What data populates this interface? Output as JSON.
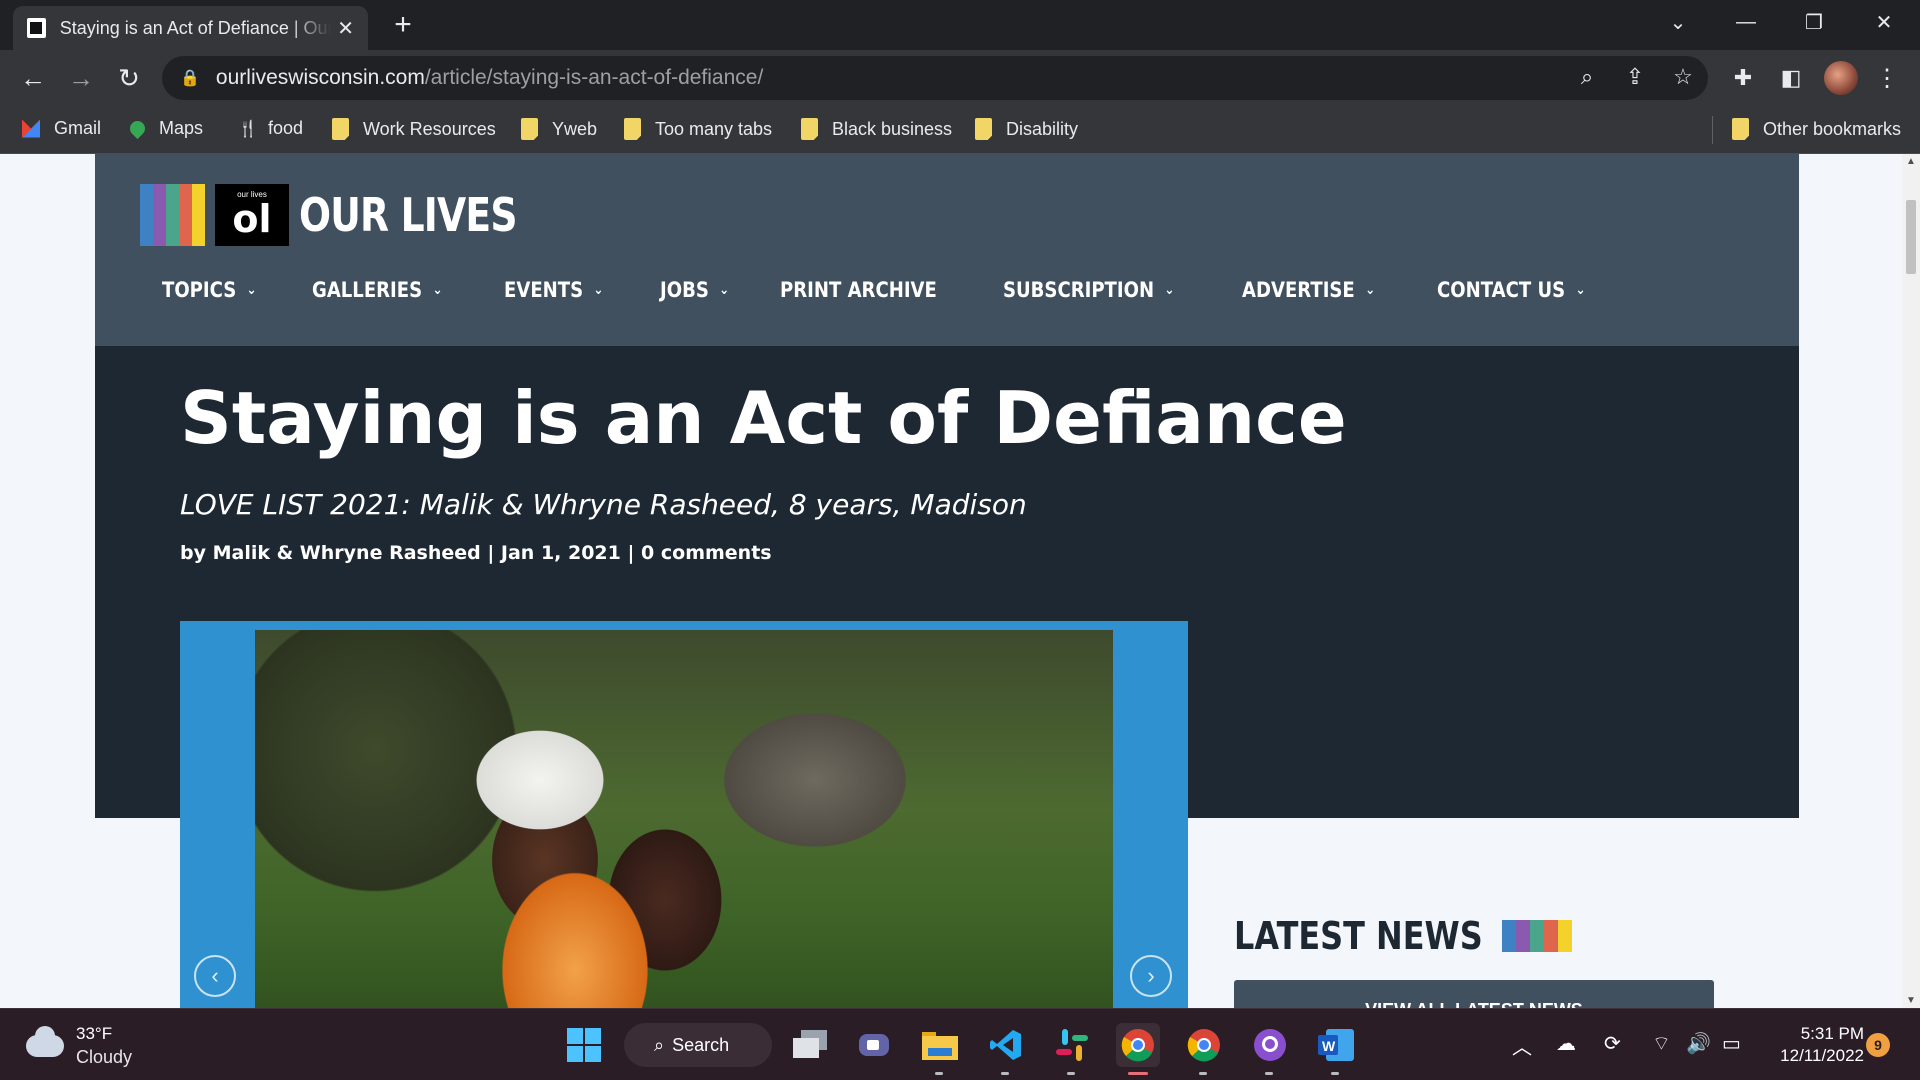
{
  "browser": {
    "tab_title": "Staying is an Act of Defiance | Our Lives",
    "url_host": "ourliveswisconsin.com",
    "url_path": "/article/staying-is-an-act-of-defiance/",
    "bookmarks": [
      {
        "label": "Gmail",
        "icon": "gmail-icon"
      },
      {
        "label": "Maps",
        "icon": "maps-icon"
      },
      {
        "label": "food",
        "icon": "food-icon"
      },
      {
        "label": "Work Resources",
        "icon": "folder-icon"
      },
      {
        "label": "Yweb",
        "icon": "folder-icon"
      },
      {
        "label": "Too many tabs",
        "icon": "folder-icon"
      },
      {
        "label": "Black business",
        "icon": "folder-icon"
      },
      {
        "label": "Disability",
        "icon": "folder-icon"
      }
    ],
    "other_bookmarks": "Other bookmarks"
  },
  "site": {
    "logo_small": "our lives",
    "logo_mark": "ol",
    "logo_text": "OUR LIVES",
    "logo_colors": [
      "#3f82c4",
      "#8a5ab0",
      "#4aa58a",
      "#e0654d",
      "#f2d22b"
    ],
    "nav": [
      {
        "label": "TOPICS",
        "dropdown": true
      },
      {
        "label": "GALLERIES",
        "dropdown": true
      },
      {
        "label": "EVENTS",
        "dropdown": true
      },
      {
        "label": "JOBS",
        "dropdown": true
      },
      {
        "label": "PRINT ARCHIVE",
        "dropdown": false
      },
      {
        "label": "SUBSCRIPTION",
        "dropdown": true
      },
      {
        "label": "ADVERTISE",
        "dropdown": true
      },
      {
        "label": "CONTACT US",
        "dropdown": true
      }
    ]
  },
  "article": {
    "title": "Staying is an Act of Defiance",
    "subtitle": "LOVE LIST 2021: Malik & Whryne Rasheed, 8 years, Madison",
    "byline_prefix": "by ",
    "author": "Malik & Whryne Rasheed",
    "date": "Jan 1, 2021",
    "comments": "0 comments",
    "gallery_prev": "‹",
    "gallery_next": "›"
  },
  "sidebar": {
    "latest_title": "LATEST NEWS",
    "button_label": "VIEW ALL LATEST NEWS"
  },
  "taskbar": {
    "temperature": "33°F",
    "condition": "Cloudy",
    "search_label": "Search",
    "time": "5:31 PM",
    "date": "12/11/2022",
    "notifications": "9"
  }
}
